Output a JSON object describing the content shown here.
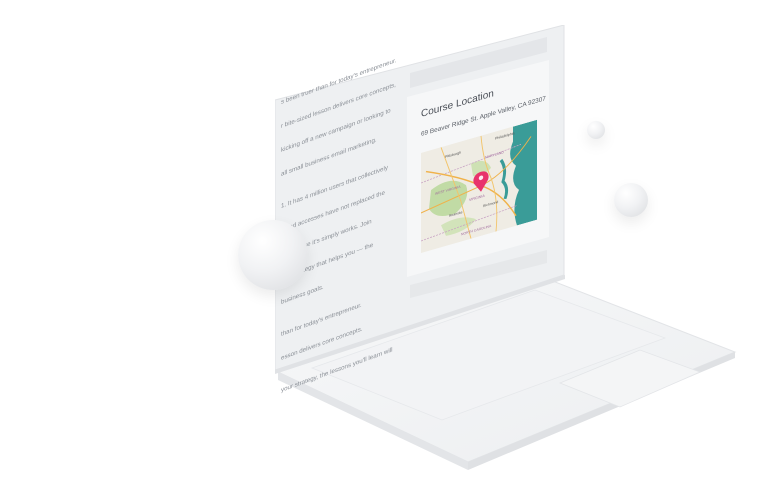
{
  "screen": {
    "left_paragraphs": [
      "s been truer than for today's entrepreneur.",
      "r bite-sized lesson delivers core concepts,",
      "kicking off a new campaign or looking to",
      "all small business email marketing.",
      "1. It has 4 million users that collectively",
      "s and accesses have not replaced the",
      "is because it's simply works. Join",
      "ting strategy that helps you — the",
      "business goals.",
      "than for today's entrepreneur.",
      "esson delivers core concepts.",
      "your strategy, the lessons you'll learn will"
    ],
    "card": {
      "title": "Course Location",
      "address": "69 Beaver Ridge St. Apple Valley, CA 92307"
    },
    "map": {
      "labels": [
        "Pittsburgh",
        "Philadelphia",
        "MARYLAND",
        "WEST VIRGINIA",
        "VIRGINIA",
        "Richmond",
        "Roanoke",
        "NORTH CAROLINA"
      ],
      "pin_color": "#e8336b",
      "water_color": "#3a9c98",
      "land_color": "#efece4",
      "forest_color": "#b8d89a",
      "road_color": "#f0b24a"
    }
  }
}
